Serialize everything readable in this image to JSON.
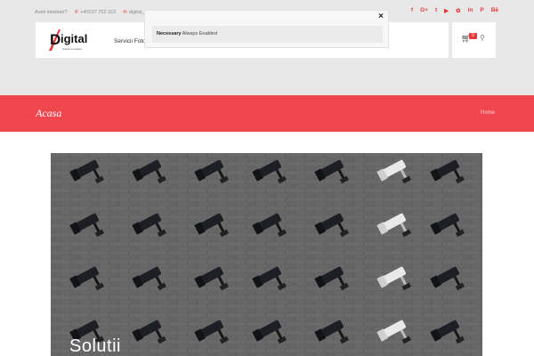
{
  "topbar": {
    "question": "Aveti intrebari?",
    "phone": "+40237 702 223",
    "email": "digital_"
  },
  "social": [
    "f",
    "G+",
    "t",
    "▶",
    "✿",
    "in",
    "P",
    "Bē"
  ],
  "header": {
    "logo_text": "igital",
    "logo_initial": "D",
    "logo_sub": "Solutii Complete",
    "nav_item": "Servicii Foto"
  },
  "cart": {
    "count": "0"
  },
  "cookie": {
    "name": "Necessary",
    "status": "Always Enabled",
    "close": "×"
  },
  "band": {
    "title": "Acasa",
    "breadcrumb": "Home"
  },
  "hero": {
    "caption": "Solutii"
  },
  "colors": {
    "accent": "#f0464e",
    "red": "#e8373b",
    "gray_bg": "#e8e8e8"
  }
}
